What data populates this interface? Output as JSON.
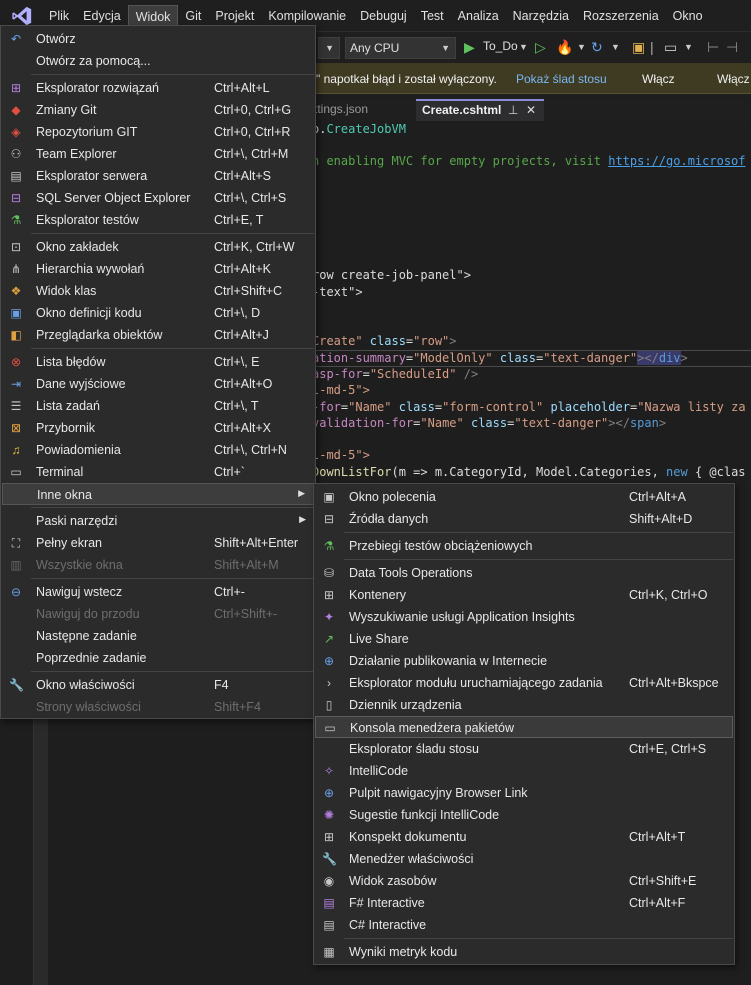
{
  "menubar": {
    "items": [
      "Plik",
      "Edycja",
      "Widok",
      "Git",
      "Projekt",
      "Kompilowanie",
      "Debuguj",
      "Test",
      "Analiza",
      "Narzędzia",
      "Rozszerzenia",
      "Okno"
    ]
  },
  "toolbar": {
    "platform": "Any CPU",
    "run_target": "To_Do"
  },
  "infobar": {
    "message": "\" napotkał błąd i został wyłączony.",
    "link": "Pokaż ślad stosu",
    "enable1": "Włącz",
    "enable2": "Włącz"
  },
  "tabs": {
    "inactive": "ttings.json",
    "active": "Create.cshtml",
    "pin": "⊥",
    "close": "✕"
  },
  "code": {
    "l1a": "o.",
    "l1b": "CreateJobVM",
    "l2a": "n enabling MVC for empty projects, visit ",
    "l2b": "https://go.microsof",
    "l3a": "row create-job-panel\">",
    "l4a": "-text\">",
    "l5a": "Create\" ",
    "l5b": "class",
    "l5c": "=",
    "l5d": "\"row\"",
    "l5e": ">",
    "l6a": "ation-summary",
    "l6b": "=",
    "l6c": "\"ModelOnly\"",
    "l6d": " class",
    "l6e": "=",
    "l6f": "\"text-danger\"",
    "l6g": "></",
    "l6h": "div",
    "l6i": ">",
    "l7a": "asp-for",
    "l7b": "=",
    "l7c": "\"ScheduleId\"",
    "l7d": " />",
    "l8a": "l-md-5\">",
    "l9a": "-for",
    "l9b": "=",
    "l9c": "\"Name\"",
    "l9d": " class",
    "l9e": "=",
    "l9f": "\"form-control\"",
    "l9g": " placeholder",
    "l9h": "=",
    "l9i": "\"Nazwa listy za",
    "l10a": "validation-for",
    "l10b": "=",
    "l10c": "\"Name\"",
    "l10d": " class",
    "l10e": "=",
    "l10f": "\"text-danger\"",
    "l10g": "></",
    "l10h": "span",
    "l10i": ">",
    "l11a": "l-md-5\">",
    "l12a": "DownListFor",
    "l12b": "(m => m.",
    "l12c": "CategoryId",
    "l12d": ", Model.",
    "l12e": "Categories",
    "l12f": ", ",
    "l12g": "new",
    "l12h": " { @clas"
  },
  "view_menu": {
    "items": [
      {
        "label": "Otwórz",
        "shortcut": "",
        "icon": "undo-arrow-icon"
      },
      {
        "label": "Otwórz za pomocą...",
        "shortcut": "",
        "icon": ""
      },
      {
        "label": "Eksplorator rozwiązań",
        "shortcut": "Ctrl+Alt+L",
        "icon": "solution-explorer-icon"
      },
      {
        "label": "Zmiany Git",
        "shortcut": "Ctrl+0, Ctrl+G",
        "icon": "git-changes-icon"
      },
      {
        "label": "Repozytorium GIT",
        "shortcut": "Ctrl+0, Ctrl+R",
        "icon": "git-repository-icon"
      },
      {
        "label": "Team Explorer",
        "shortcut": "Ctrl+\\, Ctrl+M",
        "icon": "team-explorer-icon"
      },
      {
        "label": "Eksplorator serwera",
        "shortcut": "Ctrl+Alt+S",
        "icon": "server-explorer-icon"
      },
      {
        "label": "SQL Server Object Explorer",
        "shortcut": "Ctrl+\\, Ctrl+S",
        "icon": "sql-server-icon"
      },
      {
        "label": "Eksplorator testów",
        "shortcut": "Ctrl+E, T",
        "icon": "test-explorer-icon"
      },
      {
        "label": "Okno zakładek",
        "shortcut": "Ctrl+K, Ctrl+W",
        "icon": "bookmark-window-icon"
      },
      {
        "label": "Hierarchia wywołań",
        "shortcut": "Ctrl+Alt+K",
        "icon": "call-hierarchy-icon"
      },
      {
        "label": "Widok klas",
        "shortcut": "Ctrl+Shift+C",
        "icon": "class-view-icon"
      },
      {
        "label": "Okno definicji kodu",
        "shortcut": "Ctrl+\\, D",
        "icon": "code-definition-icon"
      },
      {
        "label": "Przeglądarka obiektów",
        "shortcut": "Ctrl+Alt+J",
        "icon": "object-browser-icon"
      },
      {
        "label": "Lista błędów",
        "shortcut": "Ctrl+\\, E",
        "icon": "error-list-icon"
      },
      {
        "label": "Dane wyjściowe",
        "shortcut": "Ctrl+Alt+O",
        "icon": "output-icon"
      },
      {
        "label": "Lista zadań",
        "shortcut": "Ctrl+\\, T",
        "icon": "task-list-icon"
      },
      {
        "label": "Przybornik",
        "shortcut": "Ctrl+Alt+X",
        "icon": "toolbox-icon"
      },
      {
        "label": "Powiadomienia",
        "shortcut": "Ctrl+\\, Ctrl+N",
        "icon": "notifications-bell-icon"
      },
      {
        "label": "Terminal",
        "shortcut": "Ctrl+`",
        "icon": "terminal-icon"
      },
      {
        "label": "Inne okna",
        "shortcut": "",
        "icon": ""
      },
      {
        "label": "Paski narzędzi",
        "shortcut": "",
        "icon": ""
      },
      {
        "label": "Pełny ekran",
        "shortcut": "Shift+Alt+Enter",
        "icon": "full-screen-icon"
      },
      {
        "label": "Wszystkie okna",
        "shortcut": "Shift+Alt+M",
        "icon": "all-windows-icon"
      },
      {
        "label": "Nawiguj wstecz",
        "shortcut": "Ctrl+-",
        "icon": "navigate-back-icon"
      },
      {
        "label": "Nawiguj do przodu",
        "shortcut": "Ctrl+Shift+-",
        "icon": ""
      },
      {
        "label": "Następne zadanie",
        "shortcut": "",
        "icon": ""
      },
      {
        "label": "Poprzednie zadanie",
        "shortcut": "",
        "icon": ""
      },
      {
        "label": "Okno właściwości",
        "shortcut": "F4",
        "icon": "wrench-icon"
      },
      {
        "label": "Strony właściwości",
        "shortcut": "Shift+F4",
        "icon": ""
      }
    ]
  },
  "other_windows_menu": {
    "items": [
      {
        "label": "Okno polecenia",
        "shortcut": "Ctrl+Alt+A",
        "icon": "command-window-icon"
      },
      {
        "label": "Źródła danych",
        "shortcut": "Shift+Alt+D",
        "icon": "data-sources-icon"
      },
      {
        "label": "Przebiegi testów obciążeniowych",
        "shortcut": "",
        "icon": "load-test-icon"
      },
      {
        "label": "Data Tools Operations",
        "shortcut": "",
        "icon": "data-tools-icon"
      },
      {
        "label": "Kontenery",
        "shortcut": "Ctrl+K, Ctrl+O",
        "icon": "containers-icon"
      },
      {
        "label": "Wyszukiwanie usługi Application Insights",
        "shortcut": "",
        "icon": "application-insights-icon"
      },
      {
        "label": "Live Share",
        "shortcut": "",
        "icon": "live-share-icon"
      },
      {
        "label": "Działanie publikowania w Internecie",
        "shortcut": "",
        "icon": "globe-icon"
      },
      {
        "label": "Eksplorator modułu uruchamiającego zadania",
        "shortcut": "Ctrl+Alt+Bkspce",
        "icon": "chevron-right-icon"
      },
      {
        "label": "Dziennik urządzenia",
        "shortcut": "",
        "icon": "device-log-icon"
      },
      {
        "label": "Konsola menedżera pakietów",
        "shortcut": "",
        "icon": "package-manager-console-icon"
      },
      {
        "label": "Eksplorator śladu stosu",
        "shortcut": "Ctrl+E, Ctrl+S",
        "icon": ""
      },
      {
        "label": "IntelliCode",
        "shortcut": "",
        "icon": "intellicode-icon"
      },
      {
        "label": "Pulpit nawigacyjny Browser Link",
        "shortcut": "",
        "icon": "browser-link-icon"
      },
      {
        "label": "Sugestie funkcji IntelliCode",
        "shortcut": "",
        "icon": "lightbulb-icon"
      },
      {
        "label": "Konspekt dokumentu",
        "shortcut": "Ctrl+Alt+T",
        "icon": "document-outline-icon"
      },
      {
        "label": "Menedżer właściwości",
        "shortcut": "",
        "icon": "wrench-icon"
      },
      {
        "label": "Widok zasobów",
        "shortcut": "Ctrl+Shift+E",
        "icon": "resource-view-icon"
      },
      {
        "label": "F# Interactive",
        "shortcut": "Ctrl+Alt+F",
        "icon": "fsharp-interactive-icon"
      },
      {
        "label": "C# Interactive",
        "shortcut": "",
        "icon": "csharp-interactive-icon"
      },
      {
        "label": "Wyniki metryk kodu",
        "shortcut": "",
        "icon": "code-metrics-icon"
      }
    ]
  }
}
